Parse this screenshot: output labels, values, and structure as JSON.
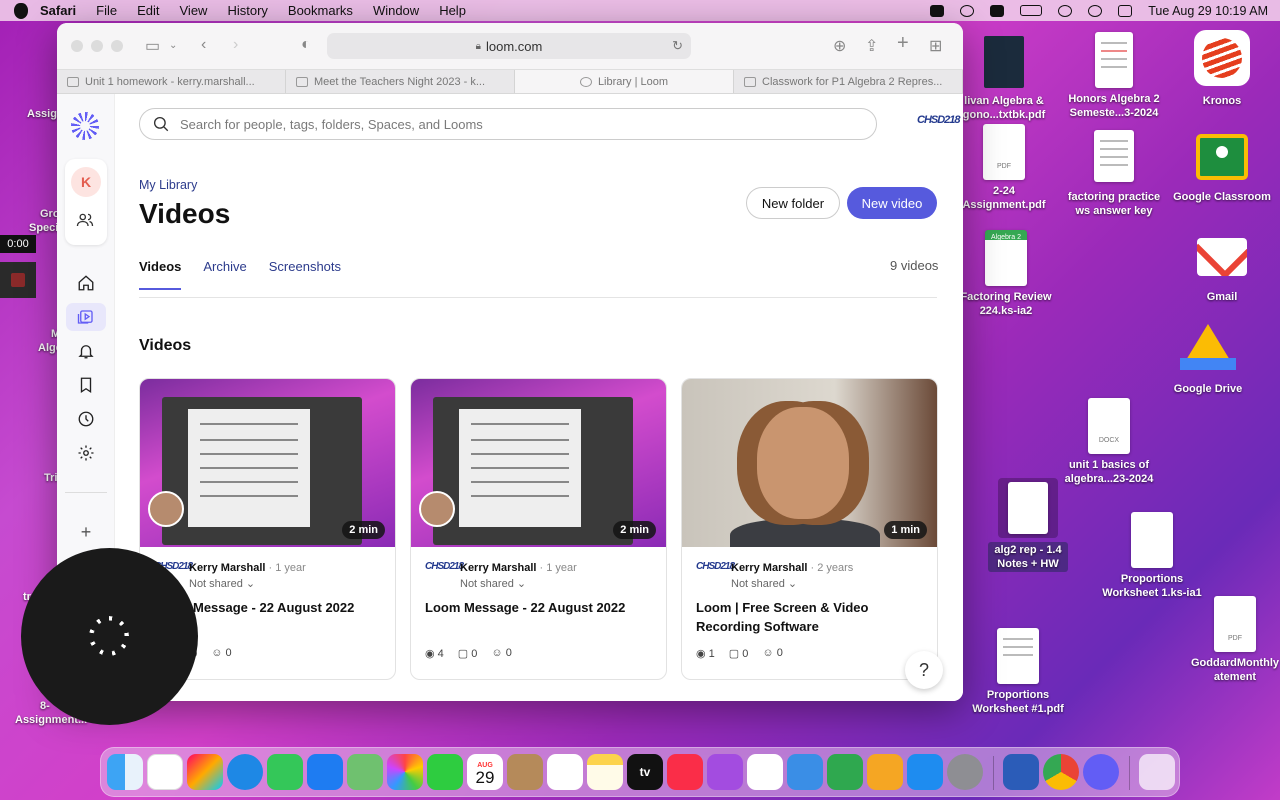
{
  "menubar": {
    "app": "Safari",
    "menus": [
      "File",
      "Edit",
      "View",
      "History",
      "Bookmarks",
      "Window",
      "Help"
    ],
    "clock": "Tue Aug 29  10:19 AM"
  },
  "desktop": {
    "icons": [
      {
        "label": "livan Algebra & gono...txtbk.pdf"
      },
      {
        "label": "Honors Algebra 2 Semeste...3-2024"
      },
      {
        "label": "Kronos"
      },
      {
        "label": "2-24 Assignment.pdf"
      },
      {
        "label": "factoring practice ws answer key"
      },
      {
        "label": "Google Classroom"
      },
      {
        "label": "Factoring Review 224.ks-ia2"
      },
      {
        "label": "Gmail"
      },
      {
        "label": "Google Drive"
      },
      {
        "label": "unit 1 basics of algebra...23-2024"
      },
      {
        "label": "alg2 rep - 1.4 Notes + HW"
      },
      {
        "label": "Proportions Worksheet 1.ks-ia1"
      },
      {
        "label": "GoddardMonthly atement"
      },
      {
        "label": "Proportions Worksheet #1.pdf"
      }
    ],
    "left_edge": [
      "Assig",
      "Gro",
      "Speci",
      "M",
      "Alge",
      "Tri",
      "tr",
      "8-",
      "Assignment..."
    ],
    "doc_badges": {
      "pdf": "PDF",
      "docx": "DOCX",
      "algebra": "Algebra 2"
    }
  },
  "recording": {
    "time": "0:00"
  },
  "browser": {
    "url": "loom.com",
    "tabs": [
      {
        "title": "Unit 1 homework - kerry.marshall..."
      },
      {
        "title": "Meet the Teachers Night 2023 - k..."
      },
      {
        "title": "Library | Loom"
      },
      {
        "title": "Classwork for P1 Algebra 2 Repres..."
      }
    ]
  },
  "loom": {
    "workspace_initial": "K",
    "search_placeholder": "Search for people, tags, folders, Spaces, and Looms",
    "district_badge": "CHSD218",
    "breadcrumb": "My Library",
    "title": "Videos",
    "new_folder": "New folder",
    "new_video": "New video",
    "tabs": [
      "Videos",
      "Archive",
      "Screenshots"
    ],
    "count": "9 videos",
    "section": "Videos",
    "help": "?",
    "avatar_badge": "CHSD218",
    "cards": [
      {
        "duration": "2 min",
        "owner": "Kerry Marshall",
        "age": "· 1 year",
        "shared": "Not shared",
        "title": "Loom Message - 22 August 2022",
        "views": "",
        "comments": "0",
        "reactions": "0"
      },
      {
        "duration": "2 min",
        "owner": "Kerry Marshall",
        "age": "· 1 year",
        "shared": "Not shared",
        "title": "Loom Message - 22 August 2022",
        "views": "4",
        "comments": "0",
        "reactions": "0"
      },
      {
        "duration": "1 min",
        "owner": "Kerry Marshall",
        "age": "· 2 years",
        "shared": "Not shared",
        "title": "Loom | Free Screen & Video Recording Software",
        "views": "1",
        "comments": "0",
        "reactions": "0"
      }
    ]
  },
  "dock": {
    "calendar_month": "AUG",
    "calendar_day": "29",
    "tv_label": "tv"
  }
}
